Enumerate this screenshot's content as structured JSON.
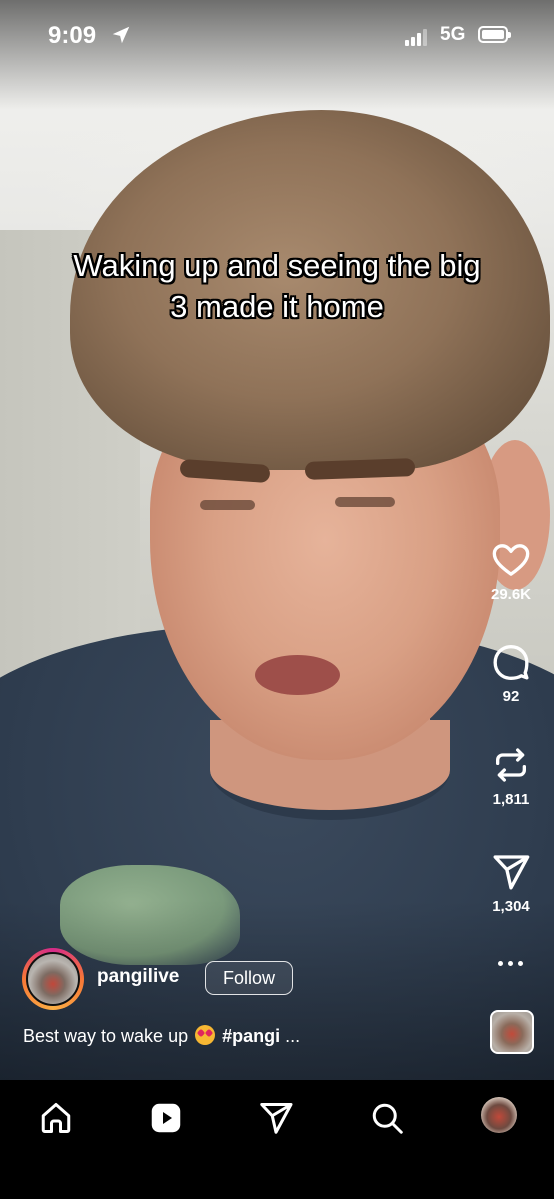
{
  "status_bar": {
    "time": "9:09",
    "network": "5G",
    "icons": [
      "location-arrow-icon",
      "signal-icon",
      "battery-icon"
    ]
  },
  "video": {
    "caption": "Waking up and seeing the big\n3 made it home"
  },
  "actions": {
    "likes": "29.6K",
    "comments": "92",
    "reposts": "1,811",
    "shares": "1,304",
    "icons": [
      "heart-icon",
      "comment-icon",
      "repost-icon",
      "share-icon",
      "more-icon"
    ]
  },
  "post": {
    "username": "pangilive",
    "follow_label": "Follow",
    "description_before": "Best way to wake up",
    "description_tag": "#pangi",
    "description_more": "..."
  },
  "nav": {
    "items": [
      "home-icon",
      "reels-icon",
      "send-icon",
      "search-icon",
      "profile-avatar"
    ]
  },
  "colors": {
    "story_ring": [
      "#d52a8a",
      "#f77737",
      "#fcaf45"
    ],
    "nav_background": "#000000",
    "text": "#ffffff"
  }
}
